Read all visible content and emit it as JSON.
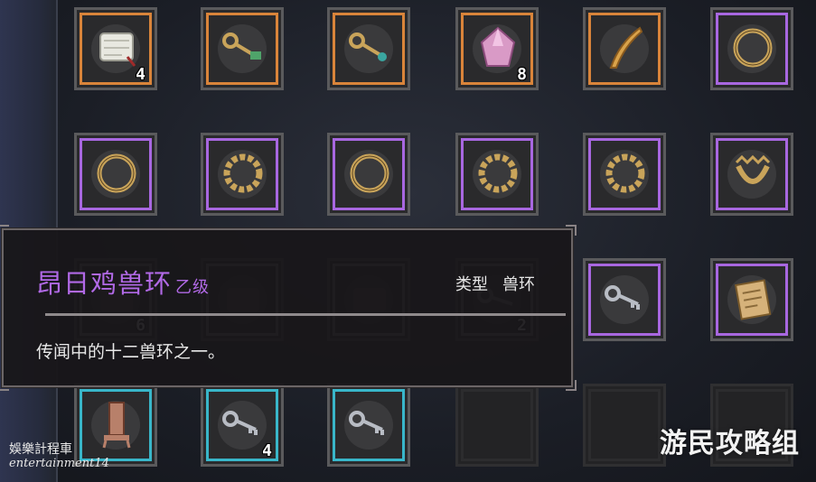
{
  "inventory": {
    "slots": [
      {
        "row": 1,
        "col": 1,
        "rarity": "orange",
        "icon": "scroll-icon",
        "qty": "4"
      },
      {
        "row": 1,
        "col": 2,
        "rarity": "orange",
        "icon": "green-key-icon",
        "qty": ""
      },
      {
        "row": 1,
        "col": 3,
        "rarity": "orange",
        "icon": "teal-key-icon",
        "qty": ""
      },
      {
        "row": 1,
        "col": 4,
        "rarity": "orange",
        "icon": "pink-crystal-icon",
        "qty": "8"
      },
      {
        "row": 1,
        "col": 5,
        "rarity": "orange",
        "icon": "feather-icon",
        "qty": ""
      },
      {
        "row": 1,
        "col": 6,
        "rarity": "purple",
        "icon": "ring-icon",
        "qty": ""
      },
      {
        "row": 2,
        "col": 1,
        "rarity": "purple",
        "icon": "ring-icon",
        "qty": ""
      },
      {
        "row": 2,
        "col": 2,
        "rarity": "purple",
        "icon": "beast-ring-icon",
        "qty": ""
      },
      {
        "row": 2,
        "col": 3,
        "rarity": "purple",
        "icon": "ring-icon",
        "qty": ""
      },
      {
        "row": 2,
        "col": 4,
        "rarity": "purple",
        "icon": "beast-ring-icon",
        "qty": ""
      },
      {
        "row": 2,
        "col": 5,
        "rarity": "purple",
        "icon": "beast-ring-icon",
        "qty": ""
      },
      {
        "row": 2,
        "col": 6,
        "rarity": "purple",
        "icon": "crown-ring-icon",
        "qty": ""
      },
      {
        "row": 3,
        "col": 1,
        "rarity": "gray",
        "icon": "cloth-icon",
        "qty": "6"
      },
      {
        "row": 3,
        "col": 2,
        "rarity": "gray",
        "icon": "cloth-icon",
        "qty": ""
      },
      {
        "row": 3,
        "col": 3,
        "rarity": "gray",
        "icon": "cloth-icon",
        "qty": ""
      },
      {
        "row": 3,
        "col": 4,
        "rarity": "gray",
        "icon": "key-icon",
        "qty": "2"
      },
      {
        "row": 3,
        "col": 5,
        "rarity": "purple",
        "icon": "silver-key-icon",
        "qty": ""
      },
      {
        "row": 3,
        "col": 6,
        "rarity": "purple",
        "icon": "parchment-icon",
        "qty": ""
      },
      {
        "row": 4,
        "col": 1,
        "rarity": "cyan",
        "icon": "chair-icon",
        "qty": ""
      },
      {
        "row": 4,
        "col": 2,
        "rarity": "cyan",
        "icon": "silver-key-icon",
        "qty": "4"
      },
      {
        "row": 4,
        "col": 3,
        "rarity": "cyan",
        "icon": "silver-key-icon",
        "qty": ""
      },
      {
        "row": 4,
        "col": 4,
        "rarity": "empty",
        "icon": "",
        "qty": ""
      },
      {
        "row": 4,
        "col": 5,
        "rarity": "empty",
        "icon": "",
        "qty": ""
      },
      {
        "row": 4,
        "col": 6,
        "rarity": "empty",
        "icon": "",
        "qty": ""
      }
    ]
  },
  "tooltip": {
    "title": "昂日鸡兽环",
    "grade": "乙级",
    "type_label": "类型",
    "type_value": "兽环",
    "description": "传闻中的十二兽环之一。"
  },
  "watermark": {
    "left_line1": "娛樂計程車",
    "left_line2": "entertainment14",
    "right": "游民攻略组"
  },
  "colors": {
    "orange": "#d9843a",
    "purple": "#a867e0",
    "cyan": "#39b6c9",
    "title": "#b169e6"
  }
}
